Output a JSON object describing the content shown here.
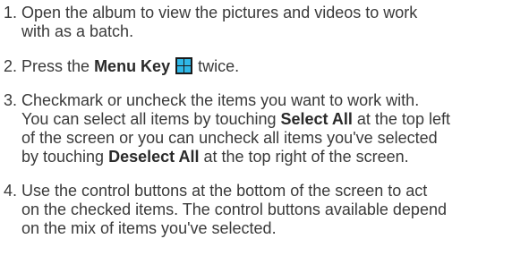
{
  "steps": [
    {
      "number": "1.",
      "line1": " Open the album to view the pictures and videos to work",
      "line2": "with as a batch."
    },
    {
      "number": "2.",
      "pre": " Press the ",
      "key_label": "Menu Key",
      "icon": "menu-key-icon",
      "post": " twice."
    },
    {
      "number": "3.",
      "line1": " Checkmark or uncheck the items you want to work with.",
      "line2_pre": "You can select all items by touching ",
      "select_all": "Select All",
      "line2_post": " at the top left",
      "line3": "of the screen or you can uncheck all items you've selected",
      "line4_pre": "by touching ",
      "deselect_all": "Deselect All",
      "line4_post": " at the top right of the screen."
    },
    {
      "number": "4.",
      "line1": " Use the control buttons at the bottom of the screen to act",
      "line2": "on the checked items. The control buttons available depend",
      "line3": "on the mix of items you've selected."
    }
  ],
  "colors": {
    "text": "#3a3a3a",
    "icon_background": "#1a1a1a",
    "icon_tiles": "#2fb8e8"
  }
}
